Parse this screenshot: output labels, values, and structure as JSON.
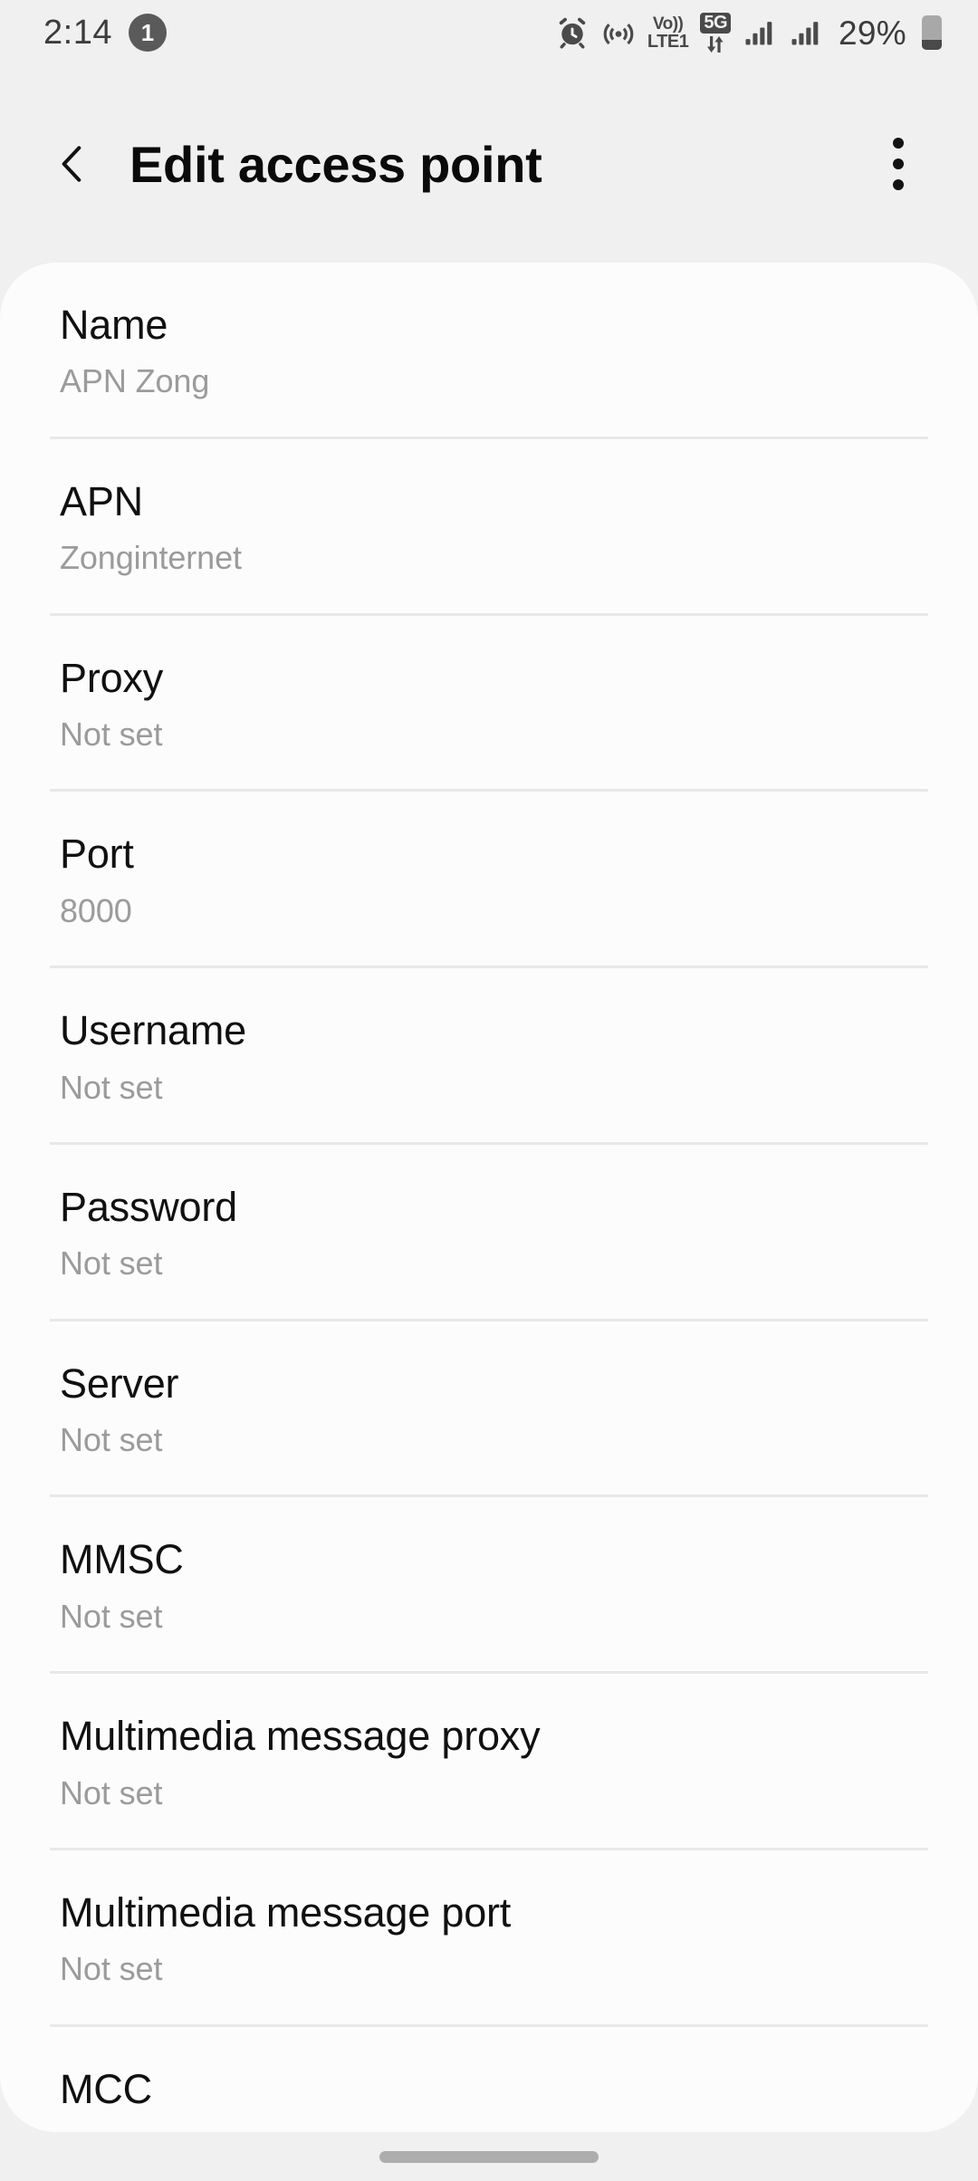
{
  "status_bar": {
    "time": "2:14",
    "notification_count": "1",
    "icons": [
      "alarm-icon",
      "hotspot-icon",
      "volte-icon",
      "5g-icon",
      "signal-sim1-icon",
      "signal-sim2-icon"
    ],
    "volte_top": "Vo))",
    "volte_bottom": "LTE1",
    "network_type": "5G",
    "battery_percent": "29%",
    "battery_level": 29
  },
  "app_bar": {
    "back_icon": "chevron-left-icon",
    "title": "Edit access point",
    "overflow_icon": "more-vertical-icon"
  },
  "settings_list": [
    {
      "label": "Name",
      "value": "APN Zong"
    },
    {
      "label": "APN",
      "value": "Zonginternet"
    },
    {
      "label": "Proxy",
      "value": "Not set"
    },
    {
      "label": "Port",
      "value": "8000"
    },
    {
      "label": "Username",
      "value": "Not set"
    },
    {
      "label": "Password",
      "value": "Not set"
    },
    {
      "label": "Server",
      "value": "Not set"
    },
    {
      "label": "MMSC",
      "value": "Not set"
    },
    {
      "label": "Multimedia message proxy",
      "value": "Not set"
    },
    {
      "label": "Multimedia message port",
      "value": "Not set"
    },
    {
      "label": "MCC",
      "value": ""
    }
  ],
  "nav_bar": {
    "gesture_handle": "home-gesture-pill"
  },
  "colors": {
    "background": "#f0f0f0",
    "card": "#fcfcfc",
    "label_text": "#101010",
    "value_text": "#9b9b9b",
    "divider": "#e8e8e8",
    "status_icon": "#4a4a4a",
    "badge": "#5a5a5a"
  }
}
